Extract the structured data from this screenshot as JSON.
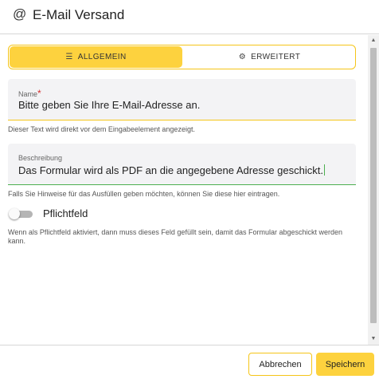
{
  "header": {
    "icon": "at-icon",
    "icon_glyph": "@",
    "title": "E-Mail Versand"
  },
  "tabs": [
    {
      "label": "ALLGEMEIN",
      "icon": "list-icon",
      "icon_glyph": "☰",
      "active": true
    },
    {
      "label": "ERWEITERT",
      "icon": "gear-icon",
      "icon_glyph": "⚙",
      "active": false
    }
  ],
  "fields": {
    "name": {
      "label": "Name",
      "required_mark": "*",
      "value": "Bitte geben Sie Ihre E-Mail-Adresse an.",
      "help": "Dieser Text wird direkt vor dem Eingabeelement angezeigt."
    },
    "description": {
      "label": "Beschreibung",
      "value": "Das Formular wird als PDF an die angegebene Adresse geschickt.",
      "help": "Falls Sie Hinweise für das Ausfüllen geben möchten, können Sie diese hier eintragen."
    }
  },
  "required_toggle": {
    "label": "Pflichtfeld",
    "checked": false,
    "help": "Wenn als Pflichtfeld aktiviert, dann muss dieses Feld gefüllt sein, damit das Formular abgeschickt werden kann."
  },
  "footer": {
    "cancel_label": "Abbrechen",
    "save_label": "Speichern"
  },
  "colors": {
    "accent": "#fdd23e",
    "accent_border": "#f5c518",
    "focus": "#4caf50",
    "required": "#d32f2f"
  }
}
